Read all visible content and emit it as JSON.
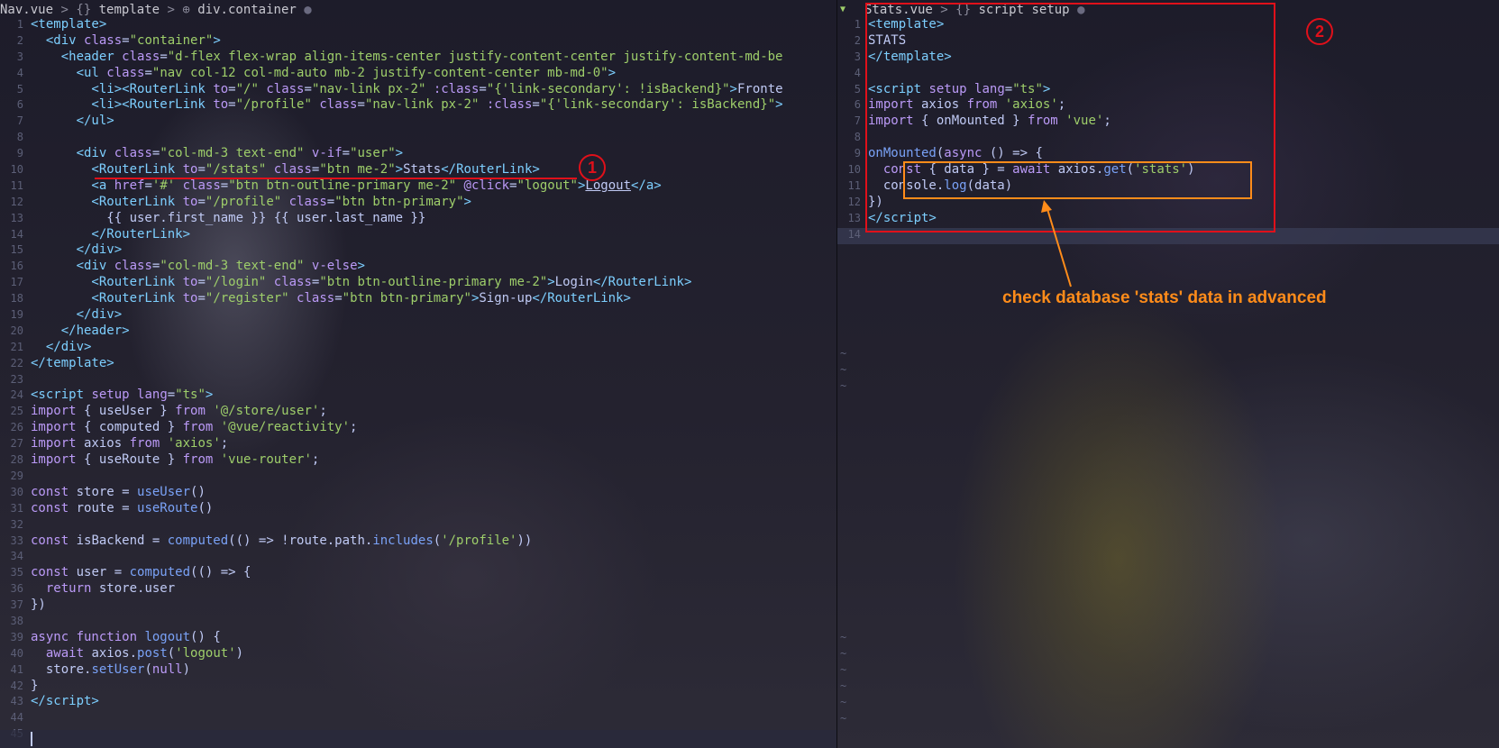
{
  "left_pane": {
    "breadcrumb": {
      "file": "Nav.vue",
      "sep1": ">",
      "icon1": "{}",
      "part1": "template",
      "sep2": ">",
      "icon2": "⊕",
      "part2": "div.container",
      "dot": "●"
    },
    "line_numbers": [
      "1",
      "2",
      "3",
      "4",
      "5",
      "6",
      "7",
      "8",
      "9",
      "10",
      "11",
      "12",
      "13",
      "14",
      "15",
      "16",
      "17",
      "18",
      "19",
      "20",
      "21",
      "22",
      "23",
      "24",
      "25",
      "26",
      "27",
      "28",
      "29",
      "30",
      "31",
      "32",
      "33",
      "34",
      "35",
      "36",
      "37",
      "38",
      "39",
      "40",
      "41",
      "42",
      "43",
      "44",
      "45"
    ]
  },
  "right_pane": {
    "breadcrumb": {
      "file": "Stats.vue",
      "sep1": ">",
      "icon1": "{}",
      "part1": "script setup",
      "dot": "●"
    },
    "line_numbers": [
      "1",
      "2",
      "3",
      "4",
      "5",
      "6",
      "7",
      "8",
      "9",
      "10",
      "11",
      "12",
      "13",
      "14"
    ]
  },
  "annotations": {
    "circle1": "1",
    "circle2": "2",
    "note": "check database 'stats' data in advanced"
  },
  "colors": {
    "red": "#e0101a",
    "orange": "#ff8c1a",
    "bg": "#1a1b26"
  }
}
